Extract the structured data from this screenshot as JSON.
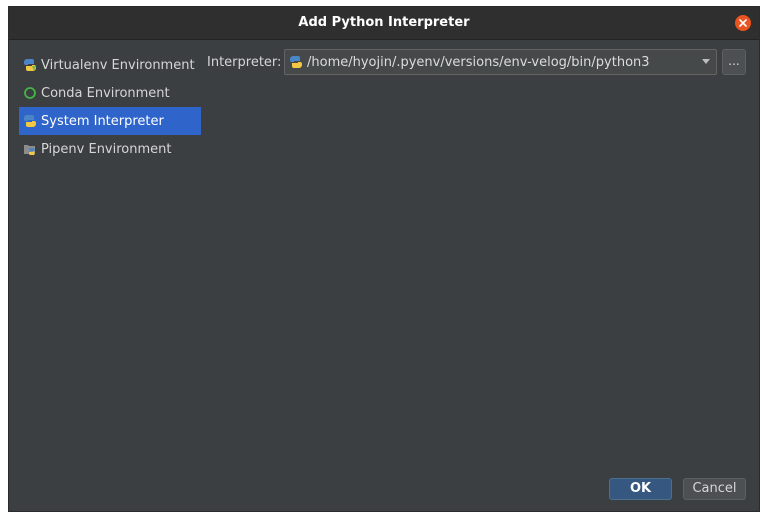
{
  "window": {
    "title": "Add Python Interpreter"
  },
  "sidebar": {
    "items": [
      {
        "label": "Virtualenv Environment",
        "icon": "python-venv-icon",
        "selected": false
      },
      {
        "label": "Conda Environment",
        "icon": "conda-ring-icon",
        "selected": false
      },
      {
        "label": "System Interpreter",
        "icon": "python-icon",
        "selected": true
      },
      {
        "label": "Pipenv Environment",
        "icon": "pipenv-icon",
        "selected": false
      }
    ]
  },
  "main": {
    "interpreter_label": "Interpreter:",
    "interpreter_value": "/home/hyojin/.pyenv/versions/env-velog/bin/python3",
    "browse_label": "..."
  },
  "footer": {
    "ok_label": "OK",
    "cancel_label": "Cancel"
  },
  "colors": {
    "accent": "#2f65ca",
    "close": "#e95420",
    "background": "#3c3f41",
    "ok_button": "#365880"
  }
}
